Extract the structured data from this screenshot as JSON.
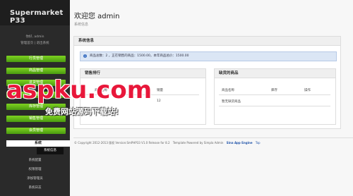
{
  "app": {
    "title": "Supermarket P33"
  },
  "user": {
    "line1": "你好, admin",
    "line2": "管理首页 | 退出系统"
  },
  "sidebar": {
    "buttons": [
      "行员管理",
      "商品管理",
      "进货管理",
      "销售管理",
      "库存管理",
      "销售管理",
      "会员管理"
    ],
    "active": "系统",
    "subitems": [
      "系统信息",
      "系统配置",
      "权限管理",
      "添加管理员",
      "系统日志"
    ]
  },
  "page": {
    "title": "欢迎您 admin",
    "subtitle": "系统信息"
  },
  "system_panel": {
    "title": "系统信息",
    "notice": "商品总数：2 ，正在销售的商品：1500.00，本年商品总价：1500.00"
  },
  "sales_panel": {
    "title": "销售排行",
    "headers": [
      "商品名称",
      "销量"
    ],
    "rows": [
      [
        "可乐",
        "12"
      ]
    ]
  },
  "stock_panel": {
    "title": "缺货的商品",
    "headers": [
      "商品名称",
      "库存",
      "操作"
    ],
    "empty": "暂无缺货商品"
  },
  "footer": {
    "text": "© Copyright 2012-2013 版权 Version:SmPHP33 V1.0 Release for 8.2",
    "right": "Template Powered by Simpla Admin",
    "badge": "Sina App Engine",
    "top": "Top"
  },
  "watermark": {
    "brand": "aspku.com",
    "slogan": "免费网站源码下载站!"
  }
}
